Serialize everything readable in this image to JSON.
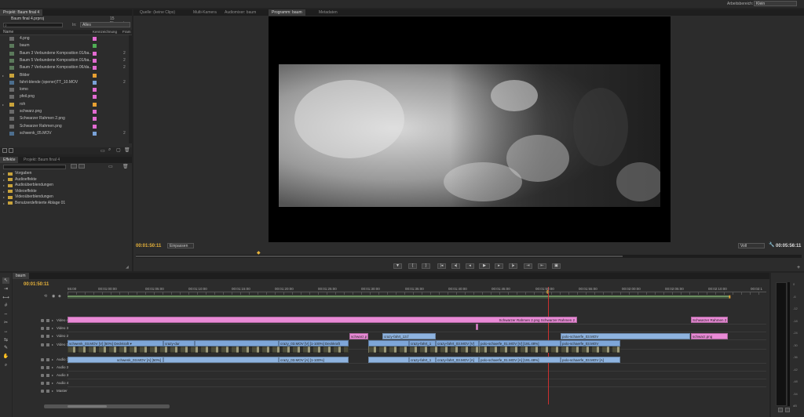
{
  "workspace": {
    "label": "Arbeitsbereich:",
    "value": "Klein"
  },
  "project": {
    "tab_label": "Projekt: Baum final 4",
    "tab2_label": "Effekte",
    "tab3_label": "Projekt: Baum final 4",
    "file_name": "Baum final 4.prproj",
    "item_count": "15 Elemente",
    "search_placeholder": "",
    "in_label": "In:",
    "in_value": "Alles",
    "columns": {
      "name": "Name",
      "label": "Kennzeichnung",
      "extra": "Fram"
    },
    "items": [
      {
        "name": "4.png",
        "icon": "still-image-icon",
        "color": "#e36bd2",
        "extra": ""
      },
      {
        "name": "baum",
        "icon": "sequence-icon",
        "color": "#4fae54",
        "extra": ""
      },
      {
        "name": "Baum 3 Verbundene Komposition 01/ba..",
        "icon": "sequence-icon",
        "color": "#e36bd2",
        "extra": "2"
      },
      {
        "name": "Baum 5 Verbundene Komposition 01/ba..",
        "icon": "sequence-icon",
        "color": "#e36bd2",
        "extra": "2"
      },
      {
        "name": "Baum 7 Verbundene Komposition 06/da..",
        "icon": "sequence-icon",
        "color": "#e36bd2",
        "extra": "2"
      },
      {
        "name": "Bilder",
        "icon": "bin-icon",
        "color": "#e8a032",
        "extra": ""
      },
      {
        "name": "fahrt-blende (opener)TT_10.MOV",
        "icon": "clip-icon",
        "color": "#7aa2d8",
        "extra": "2"
      },
      {
        "name": "lomo",
        "icon": "still-image-icon",
        "color": "#e36bd2",
        "extra": ""
      },
      {
        "name": "pfeil.png",
        "icon": "still-image-icon",
        "color": "#e36bd2",
        "extra": ""
      },
      {
        "name": "roh",
        "icon": "bin-icon",
        "color": "#e8a032",
        "extra": ""
      },
      {
        "name": "schwarz.png",
        "icon": "still-image-icon",
        "color": "#e36bd2",
        "extra": ""
      },
      {
        "name": "Schwarzer Rahmen 2.png",
        "icon": "still-image-icon",
        "color": "#e36bd2",
        "extra": ""
      },
      {
        "name": "Schwarzer Rahmen.png",
        "icon": "still-image-icon",
        "color": "#e36bd2",
        "extra": ""
      },
      {
        "name": "schwenk_05.MOV",
        "icon": "clip-icon",
        "color": "#7aa2d8",
        "extra": "2"
      }
    ]
  },
  "effects": {
    "items": [
      "Vorgaben",
      "Audioeffekte",
      "Audioüberblendungen",
      "Videoeffekte",
      "Videoüberblendungen",
      "Benutzerdefinierte Ablage 01"
    ]
  },
  "monitor_tabs": [
    "Quelle: (keine Clips)",
    "Multi-Kamera",
    "Audiomixer: baum",
    "Programm: baum",
    "Metadaten"
  ],
  "program": {
    "timecode": "00:01:50:11",
    "fit_label": "Einpassen",
    "quality": "Voll",
    "duration": "00:05:56:11"
  },
  "transport_buttons": [
    "▼",
    "{",
    "}",
    "|◂",
    "◂|",
    "◂",
    "▶",
    "▸",
    "|▸",
    "⇥",
    "⇤",
    "▣"
  ],
  "timeline": {
    "tab": "baum",
    "timecode": "00:01:50:11",
    "ruler": [
      "55:00",
      "00:01:00:00",
      "00:01:05:00",
      "00:01:10:00",
      "00:01:15:00",
      "00:01:20:00",
      "00:01:25:00",
      "00:01:30:00",
      "00:01:35:00",
      "00:01:40:00",
      "00:01:45:00",
      "00:01:50:00",
      "00:01:55:00",
      "00:02:00:00",
      "00:02:05:00",
      "00:02:10:00",
      "00:02:1"
    ],
    "tracks": [
      "Video 4",
      "Video 3",
      "Video 2",
      "Video 1",
      "Audio 1",
      "Audio 2",
      "Audio 3",
      "Audio 4",
      "Master"
    ],
    "clips": {
      "v4_a": "Schwarzer Rahmen 2.png Schwarzer Rahmen 2",
      "v4_b": "Schwarzer Rahmen 2",
      "v2_a": "schwarz.p",
      "v2_b": "crazy-fahrt_13.f",
      "v2_c": "polo-schaerfe_03.MOV",
      "v2_d": "schwarz.png",
      "v1_a": "schwenk_03.MOV [V] [50%] Deckkraft ▾",
      "v1_b": "crazy-dur",
      "v1_c": "crazy_03.MOV [V] [1-100%] Deckkraft",
      "v1_d": "crazy-fahrt_1",
      "v1_e": "crazy-fahrt_03.MOV [V]",
      "v1_f": "polo-schaerfe_01.MOV [V] [191.48%]",
      "v1_g": "polo-schaerfe_03.MOV",
      "a1_a": "schwenk_03.MOV [A] [50%]",
      "a1_b": "crazy_03.MOV [A] [1-100%]",
      "a1_c": "crazy-fahrt_1",
      "a1_d": "crazy-fahrt_03.MOV [A]",
      "a1_e": "polo-schaerfe_01.MOV [A] [191.48%]",
      "a1_f": "polo-schaerfe_03.MOV [A]"
    }
  },
  "meter_scale": [
    "0",
    "-6",
    "-12",
    "-18",
    "-24",
    "-30",
    "-36",
    "-42",
    "-48",
    "-54",
    "dB"
  ],
  "colors": {
    "accent_timecode": "#e8b33a",
    "playhead": "#cc3030",
    "pink_clip": "#e98ad6",
    "blue_clip": "#8eb3df"
  }
}
